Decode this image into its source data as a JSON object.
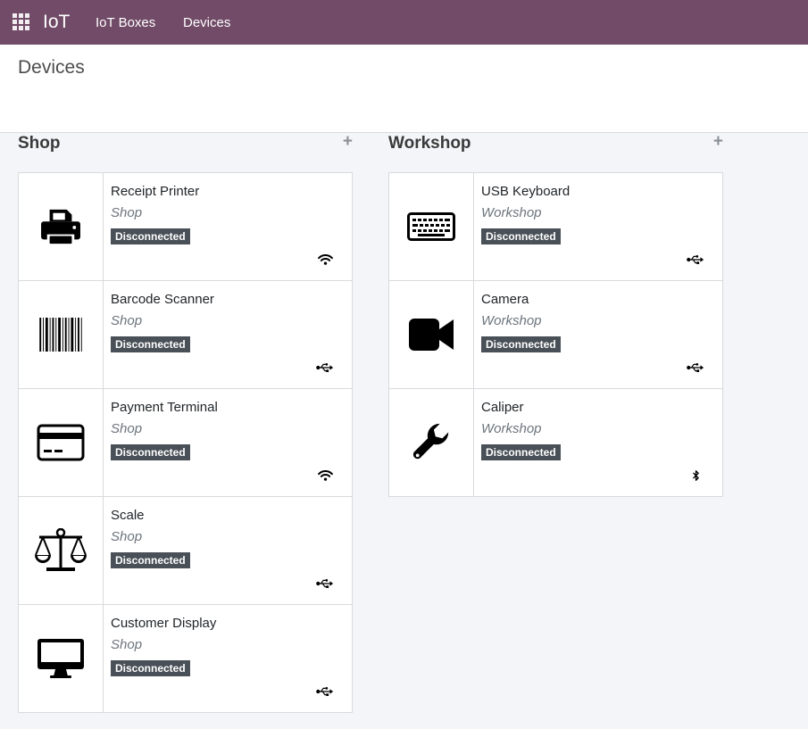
{
  "nav": {
    "brand": "IoT",
    "menu": [
      "IoT Boxes",
      "Devices"
    ]
  },
  "page": {
    "title": "Devices"
  },
  "colors": {
    "navbar": "#714b67",
    "badge": "#495057"
  },
  "groups": [
    {
      "title": "Shop",
      "add_icon": "plus-icon",
      "devices": [
        {
          "name": "Receipt Printer",
          "location": "Shop",
          "status": "Disconnected",
          "icon": "printer-icon",
          "connection": "wifi-icon"
        },
        {
          "name": "Barcode Scanner",
          "location": "Shop",
          "status": "Disconnected",
          "icon": "barcode-icon",
          "connection": "usb-icon"
        },
        {
          "name": "Payment Terminal",
          "location": "Shop",
          "status": "Disconnected",
          "icon": "credit-card-icon",
          "connection": "wifi-icon"
        },
        {
          "name": "Scale",
          "location": "Shop",
          "status": "Disconnected",
          "icon": "balance-scale-icon",
          "connection": "usb-icon"
        },
        {
          "name": "Customer Display",
          "location": "Shop",
          "status": "Disconnected",
          "icon": "desktop-icon",
          "connection": "usb-icon"
        }
      ]
    },
    {
      "title": "Workshop",
      "add_icon": "plus-icon",
      "devices": [
        {
          "name": "USB Keyboard",
          "location": "Workshop",
          "status": "Disconnected",
          "icon": "keyboard-icon",
          "connection": "usb-icon"
        },
        {
          "name": "Camera",
          "location": "Workshop",
          "status": "Disconnected",
          "icon": "video-camera-icon",
          "connection": "usb-icon"
        },
        {
          "name": "Caliper",
          "location": "Workshop",
          "status": "Disconnected",
          "icon": "wrench-icon",
          "connection": "bluetooth-icon"
        }
      ]
    }
  ]
}
